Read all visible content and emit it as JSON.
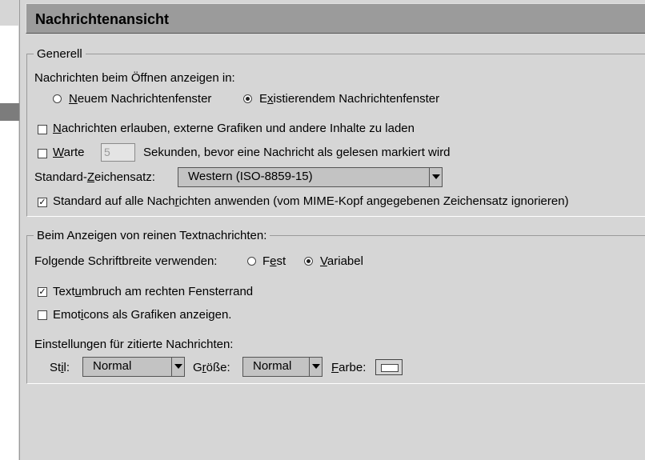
{
  "header": {
    "title": "Nachrichtenansicht"
  },
  "generell": {
    "legend": "Generell",
    "open_in_label": "Nachrichten beim Öffnen anzeigen in:",
    "radio_new": {
      "pre": "",
      "u": "N",
      "post": "euem Nachrichtenfenster"
    },
    "radio_existing": {
      "pre": "E",
      "u": "x",
      "post": "istierendem Nachrichtenfenster"
    },
    "allow_remote": {
      "pre": "",
      "u": "N",
      "post": "achrichten erlauben, externe Grafiken und andere Inhalte zu laden"
    },
    "wait": {
      "pre": "",
      "u": "W",
      "post": "arte",
      "value": "5",
      "suffix": "Sekunden, bevor eine Nachricht als gelesen markiert wird"
    },
    "charset": {
      "pre": "Standard-",
      "u": "Z",
      "post": "eichensatz:",
      "value": "Western (ISO-8859-15)"
    },
    "apply_default": {
      "pre": "Standard auf alle Nach",
      "u": "r",
      "post": "ichten anwenden (vom MIME-Kopf angegebenen Zeichensatz ignorieren)"
    }
  },
  "plain": {
    "legend": "Beim Anzeigen von reinen Textnachrichten:",
    "font_width_label": "Folgende Schriftbreite verwenden:",
    "radio_fixed": {
      "pre": "F",
      "u": "e",
      "post": "st"
    },
    "radio_variable": {
      "pre": "",
      "u": "V",
      "post": "ariabel"
    },
    "wrap": {
      "pre": "Text",
      "u": "u",
      "post": "mbruch am rechten Fensterrand"
    },
    "emoticons": {
      "pre": "Emot",
      "u": "i",
      "post": "cons als Grafiken anzeigen."
    },
    "quoted_label": "Einstellungen für zitierte Nachrichten:",
    "style": {
      "pre": "St",
      "u": "i",
      "post": "l:",
      "value": "Normal"
    },
    "size": {
      "pre": "G",
      "u": "r",
      "post": "öße:",
      "value": "Normal"
    },
    "color": {
      "pre": "",
      "u": "F",
      "post": "arbe:"
    }
  }
}
